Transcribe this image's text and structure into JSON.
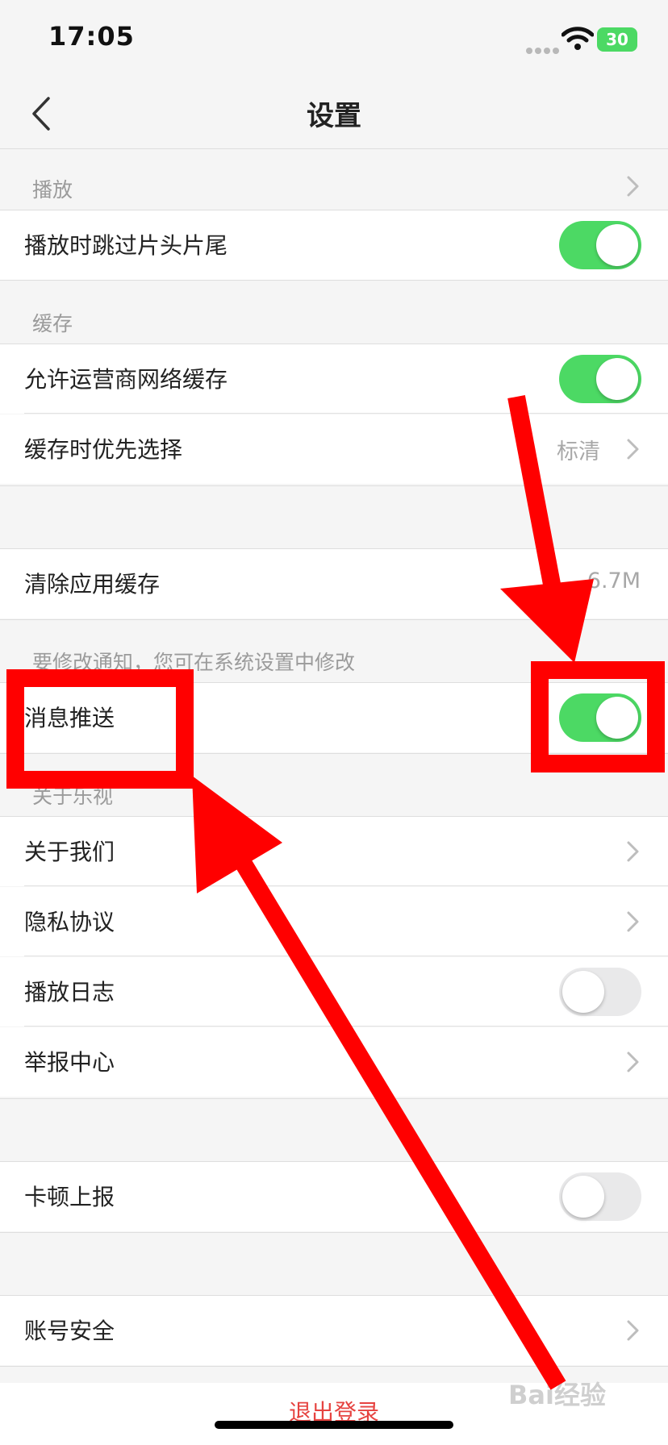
{
  "status_bar": {
    "time": "17:05",
    "battery": "30"
  },
  "nav": {
    "title": "设置"
  },
  "sections": {
    "play": {
      "label": "播放",
      "rows": {
        "skip_intro": {
          "label": "播放时跳过片头片尾",
          "enabled": true
        }
      }
    },
    "cache": {
      "label": "缓存",
      "rows": {
        "carrier_cache": {
          "label": "允许运营商网络缓存",
          "enabled": true
        },
        "cache_priority": {
          "label": "缓存时优先选择",
          "value": "标清"
        }
      }
    },
    "clear": {
      "rows": {
        "clear_cache": {
          "label": "清除应用缓存",
          "value": "6.7M"
        }
      }
    },
    "notify": {
      "label": "要修改通知，您可在系统设置中修改",
      "rows": {
        "push": {
          "label": "消息推送",
          "enabled": true
        }
      }
    },
    "about": {
      "label": "关于乐视",
      "rows": {
        "about_us": {
          "label": "关于我们"
        },
        "privacy": {
          "label": "隐私协议"
        },
        "play_log": {
          "label": "播放日志",
          "enabled": false
        },
        "report": {
          "label": "举报中心"
        }
      }
    },
    "stutter": {
      "rows": {
        "stutter_report": {
          "label": "卡顿上报",
          "enabled": false
        }
      }
    },
    "account": {
      "rows": {
        "security": {
          "label": "账号安全"
        }
      }
    }
  },
  "logout": {
    "label": "退出登录"
  },
  "watermark": {
    "text": "Bai经验"
  },
  "colors": {
    "toggle_on": "#4cd964",
    "annotation": "#ff0000",
    "logout": "#e64340"
  }
}
